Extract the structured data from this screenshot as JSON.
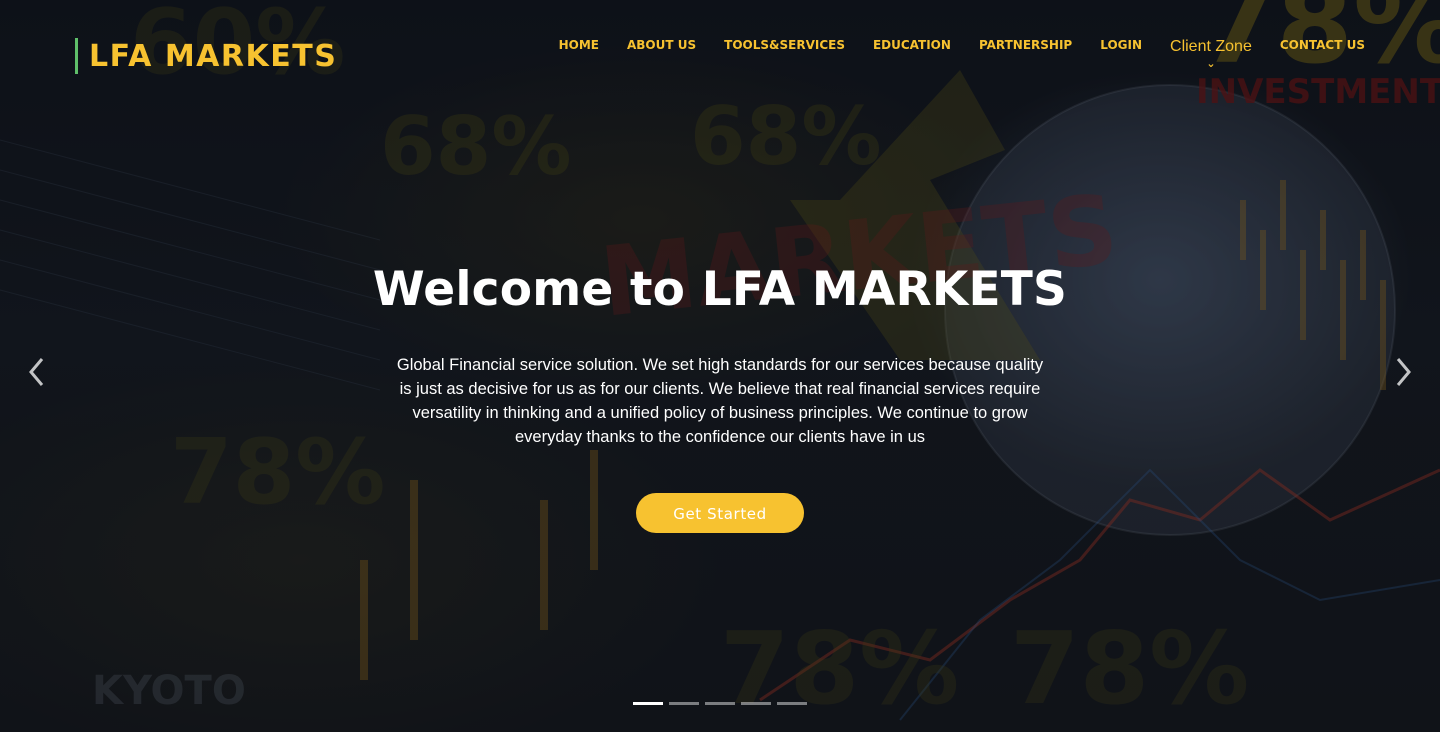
{
  "brand": {
    "name": "LFA MARKETS",
    "accent_color": "#f7c230",
    "bar_color": "#5fbf6a"
  },
  "nav": {
    "items": [
      {
        "label": "HOME"
      },
      {
        "label": "ABOUT US"
      },
      {
        "label": "TOOLS&SERVICES"
      },
      {
        "label": "EDUCATION"
      },
      {
        "label": "PARTNERSHIP"
      },
      {
        "label": "LOGIN"
      }
    ],
    "dropdown": {
      "label": "Client Zone",
      "icon": "chevron-down-icon"
    },
    "last": {
      "label": "CONTACT US"
    }
  },
  "hero": {
    "title": "Welcome to LFA MARKETS",
    "description": "Global Financial service solution. We set high standards for our services because quality is just as decisive for us as for our clients. We believe that real financial services require versatility in thinking and a unified policy of business principles. We continue to grow everyday thanks to the confidence our clients have in us",
    "cta_label": "Get Started",
    "cta_color": "#f7c230"
  },
  "background_text": {
    "big": "78%",
    "investment": "INVESTMENT",
    "pct68a": "68%",
    "pct68b": "68%",
    "pct60": "60%",
    "pct78a": "78%",
    "pct78b": "78%",
    "pct78c": "78%",
    "markets": "MARKETS",
    "kyoto": "KYOTO"
  },
  "carousel": {
    "prev_icon": "chevron-left-icon",
    "next_icon": "chevron-right-icon",
    "slide_count": 5,
    "active_index": 0
  }
}
